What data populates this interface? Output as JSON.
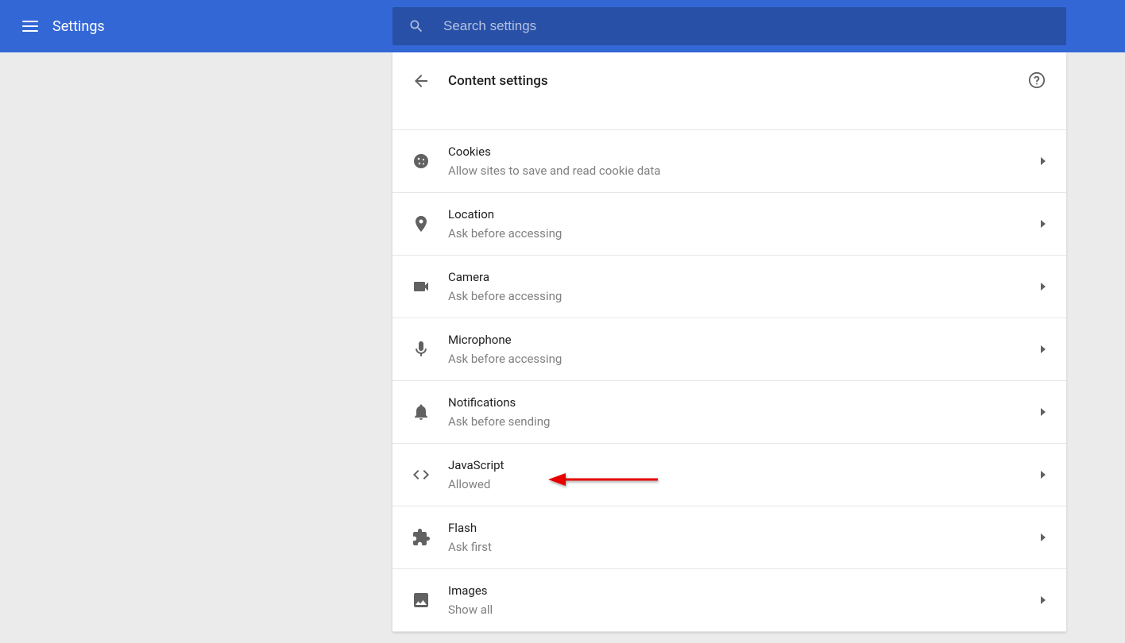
{
  "app": {
    "title": "Settings"
  },
  "search": {
    "placeholder": "Search settings"
  },
  "page": {
    "title": "Content settings"
  },
  "rows": [
    {
      "icon": "cookie",
      "title": "Cookies",
      "sub": "Allow sites to save and read cookie data"
    },
    {
      "icon": "location",
      "title": "Location",
      "sub": "Ask before accessing"
    },
    {
      "icon": "camera",
      "title": "Camera",
      "sub": "Ask before accessing"
    },
    {
      "icon": "microphone",
      "title": "Microphone",
      "sub": "Ask before accessing"
    },
    {
      "icon": "bell",
      "title": "Notifications",
      "sub": "Ask before sending"
    },
    {
      "icon": "code",
      "title": "JavaScript",
      "sub": "Allowed"
    },
    {
      "icon": "extension",
      "title": "Flash",
      "sub": "Ask first"
    },
    {
      "icon": "image",
      "title": "Images",
      "sub": "Show all"
    }
  ]
}
